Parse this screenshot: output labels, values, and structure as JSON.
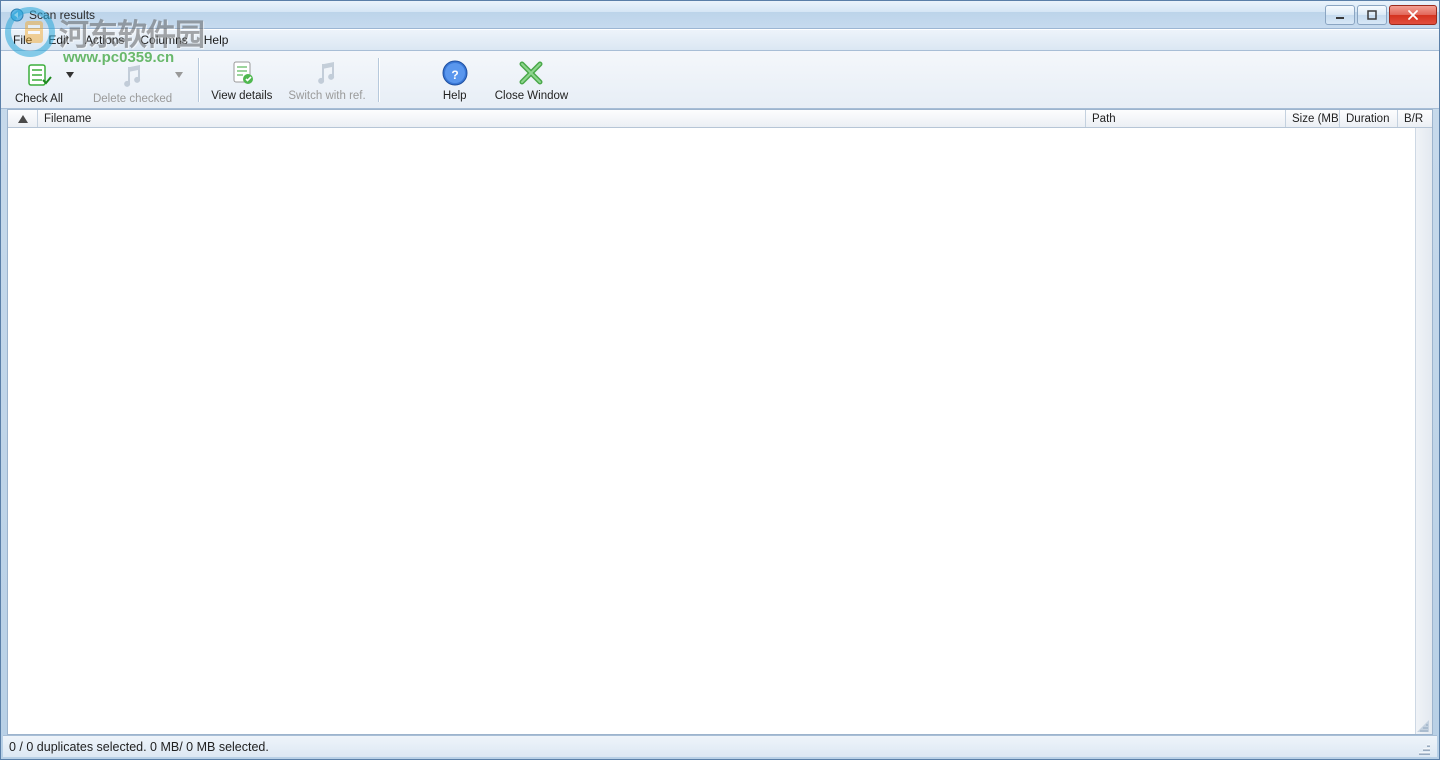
{
  "window": {
    "title": "Scan results"
  },
  "menu": {
    "file": "File",
    "edit": "Edit",
    "actions": "Actions",
    "columns": "Columns",
    "help": "Help"
  },
  "toolbar": {
    "check_all": "Check All",
    "delete_checked": "Delete checked",
    "view_details": "View details",
    "switch_ref": "Switch with ref.",
    "help": "Help",
    "close_window": "Close Window"
  },
  "columns": {
    "filename": "Filename",
    "path": "Path",
    "size": "Size (MB)",
    "duration": "Duration",
    "br": "B/R"
  },
  "status": {
    "text": "0 / 0 duplicates selected. 0 MB/ 0 MB selected."
  },
  "watermark": {
    "text": "河东软件园",
    "url": "www.pc0359.cn"
  }
}
